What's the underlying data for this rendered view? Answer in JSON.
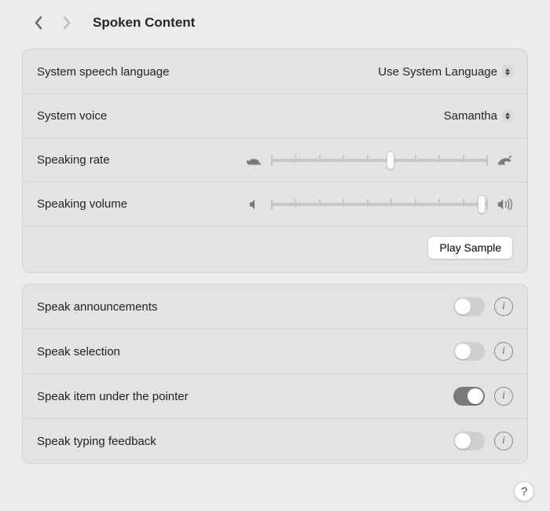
{
  "header": {
    "title": "Spoken Content"
  },
  "section1": {
    "lang_label": "System speech language",
    "lang_value": "Use System Language",
    "voice_label": "System voice",
    "voice_value": "Samantha",
    "rate_label": "Speaking rate",
    "rate_pct": 55,
    "volume_label": "Speaking volume",
    "volume_pct": 97,
    "play_label": "Play Sample"
  },
  "section2": {
    "rows": [
      {
        "label": "Speak announcements",
        "on": false
      },
      {
        "label": "Speak selection",
        "on": false
      },
      {
        "label": "Speak item under the pointer",
        "on": true
      },
      {
        "label": "Speak typing feedback",
        "on": false
      }
    ]
  },
  "help_char": "?",
  "info_char": "i"
}
